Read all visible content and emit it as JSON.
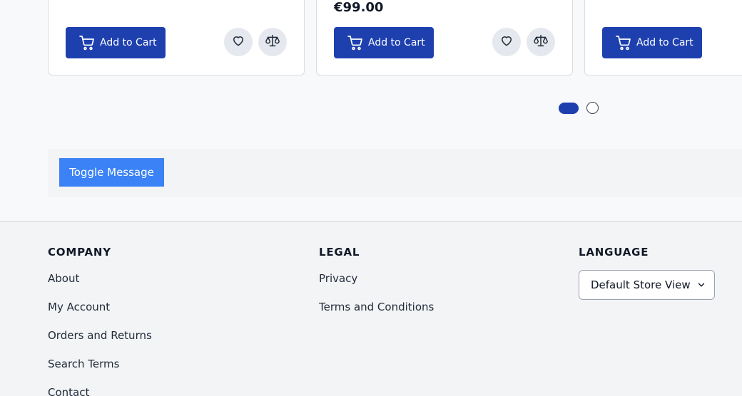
{
  "products": [
    {
      "price": "",
      "add_to_cart": "Add to Cart",
      "has_actions": true
    },
    {
      "price": "€99.00",
      "add_to_cart": "Add to Cart",
      "has_actions": true
    },
    {
      "price": "",
      "add_to_cart": "Add to Cart",
      "has_actions": false
    }
  ],
  "carousel": {
    "pages": 2,
    "active_page": 1
  },
  "message": {
    "toggle_label": "Toggle Message"
  },
  "footer": {
    "company": {
      "heading": "COMPANY",
      "links": [
        "About",
        "My Account",
        "Orders and Returns",
        "Search Terms",
        "Contact"
      ]
    },
    "legal": {
      "heading": "LEGAL",
      "links": [
        "Privacy",
        "Terms and Conditions"
      ]
    },
    "language": {
      "heading": "LANGUAGE",
      "selected": "Default Store View"
    }
  },
  "icons": {
    "cart": "cart-icon",
    "wishlist": "heart-icon",
    "compare": "scale-icon",
    "dropdown": "chevron-down-icon"
  },
  "colors": {
    "primary": "#1e40af",
    "toggle": "#3b82f6"
  }
}
